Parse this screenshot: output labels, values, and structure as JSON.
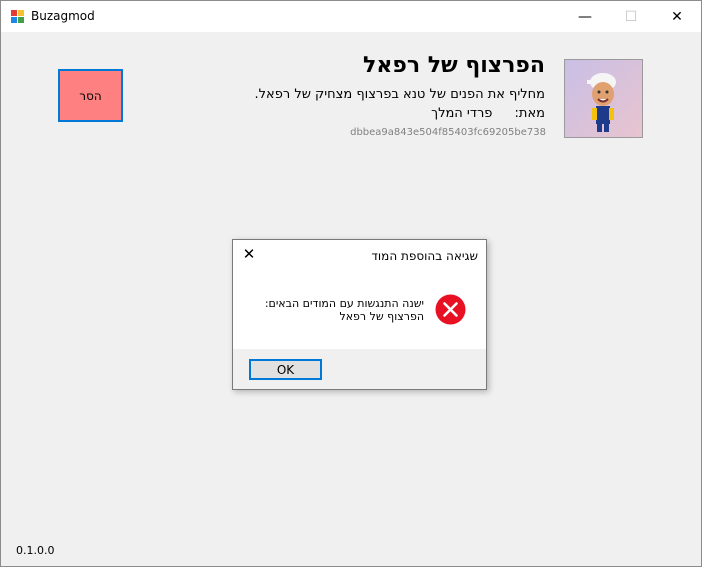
{
  "window": {
    "title": "Buzagmod",
    "controls": {
      "minimize": "—",
      "maximize": "☐",
      "close": "✕"
    }
  },
  "mod": {
    "title": "הפרצוף של רפאל",
    "description": "מחליף את הפנים של טנא בפרצוף מצחיק של רפאל.",
    "author_label": "מאת:",
    "author": "פרדי המלך",
    "hash": "dbbea9a843e504f85403fc69205be738",
    "remove_label": "הסר",
    "remove_color": "#ff8080"
  },
  "version": "0.1.0.0",
  "dialog": {
    "title": "שגיאה בהוספת המוד",
    "close": "✕",
    "message_line1": "ישנה התנגשות עם המודים הבאים:",
    "message_line2": "הפרצוף של רפאל",
    "ok_label": "OK",
    "icon": "error-icon",
    "icon_color": "#e81123"
  },
  "colors": {
    "accent": "#0078d7"
  }
}
